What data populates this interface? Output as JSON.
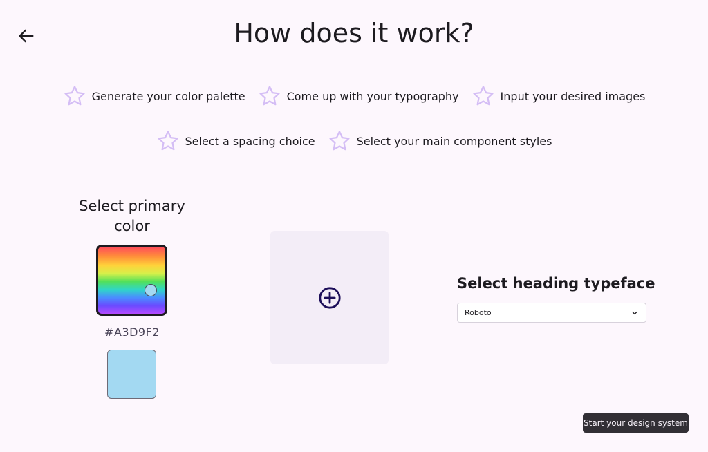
{
  "header": {
    "title": "How does it work?",
    "back_icon": "arrow-left-icon"
  },
  "steps": {
    "icon": "star-outline-icon",
    "icon_color": "#d4bdf5",
    "row1": [
      {
        "label": "Generate your color palette"
      },
      {
        "label": "Come up with your typography"
      },
      {
        "label": "Input your desired images"
      }
    ],
    "row2": [
      {
        "label": "Select a spacing choice"
      },
      {
        "label": "Select your main component styles"
      }
    ]
  },
  "color_section": {
    "title": "Select primary color",
    "hex": "#A3D9F2",
    "swatch_color": "#A3D9F2"
  },
  "image_upload": {
    "icon": "plus-circle-icon",
    "icon_color": "#1d0f5a"
  },
  "typeface_section": {
    "title": "Select heading typeface",
    "selected": "Roboto",
    "chevron_icon": "chevron-down-icon"
  },
  "cta": {
    "label": "Start your design system"
  }
}
